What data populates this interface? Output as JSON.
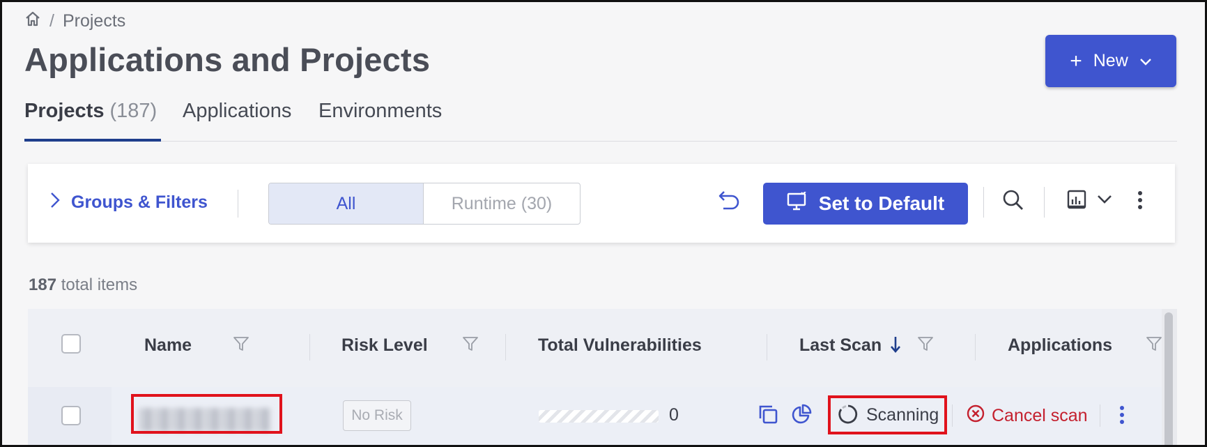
{
  "breadcrumb": {
    "separator": "/",
    "current": "Projects"
  },
  "page": {
    "title": "Applications and Projects"
  },
  "header": {
    "new_button": "New"
  },
  "tabs": [
    {
      "label": "Projects",
      "count": "(187)",
      "active": true
    },
    {
      "label": "Applications"
    },
    {
      "label": "Environments"
    }
  ],
  "toolbar": {
    "groups_filters": "Groups & Filters",
    "segments": [
      {
        "label": "All",
        "selected": true
      },
      {
        "label": "Runtime (30)"
      }
    ],
    "set_default": "Set to Default"
  },
  "summary": {
    "count": "187",
    "label": "total items"
  },
  "table": {
    "columns": [
      "Name",
      "Risk Level",
      "Total Vulnerabilities",
      "Last Scan",
      "Applications"
    ],
    "rows": [
      {
        "risk": "No Risk",
        "vulnerabilities": "0",
        "status": "Scanning",
        "action": "Cancel scan"
      }
    ]
  },
  "colors": {
    "primary": "#3f55cf",
    "highlight": "#e0121c",
    "danger": "#c4202e",
    "tab_underline": "#1f3e8c"
  },
  "icons": [
    "home-icon",
    "plus-icon",
    "chevron-down-icon",
    "chevron-right-icon",
    "undo-icon",
    "monitor-icon",
    "search-icon",
    "report-icon",
    "more-vertical-icon",
    "filter-icon",
    "sort-down-arrow-icon",
    "copy-icon",
    "pie-chart-icon",
    "spinner-icon",
    "cancel-circle-icon"
  ]
}
